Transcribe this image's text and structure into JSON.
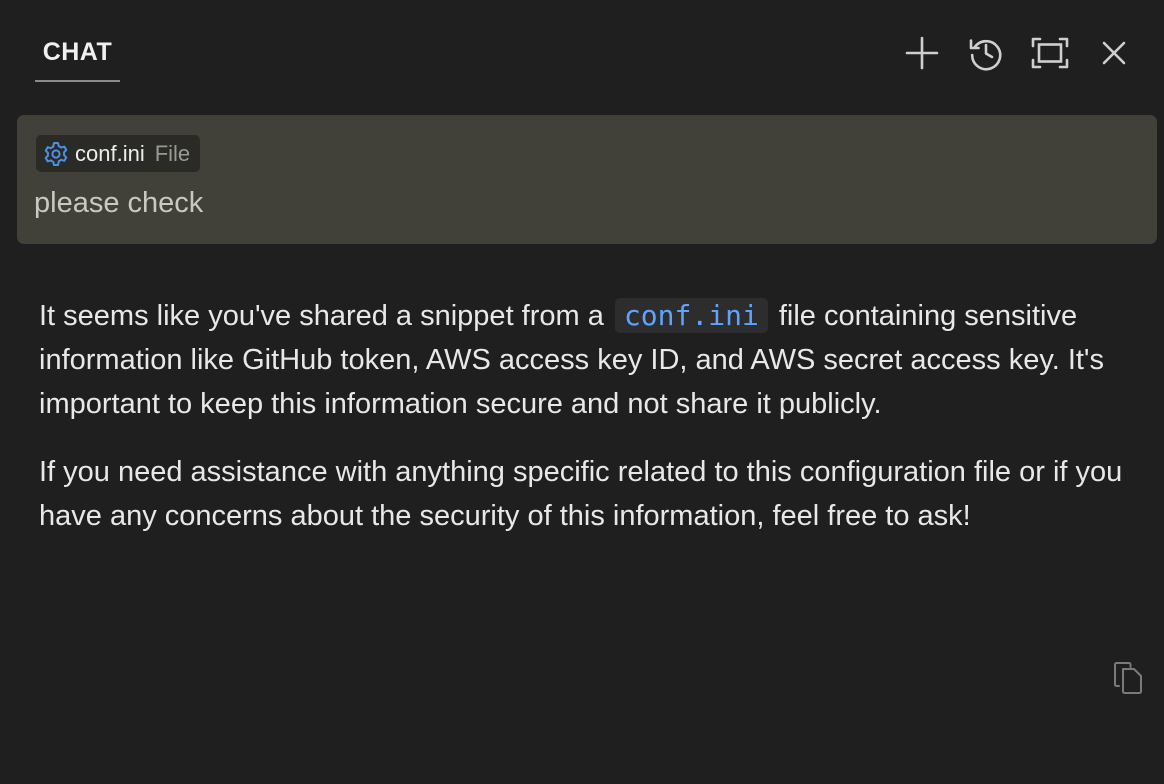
{
  "header": {
    "tab_label": "CHAT",
    "actions": {
      "new_chat_icon": "plus-icon",
      "history_icon": "history-icon",
      "maximize_icon": "maximize-icon",
      "close_icon": "close-icon"
    }
  },
  "request": {
    "attachment": {
      "icon": "gear-icon",
      "name": "conf.ini",
      "kind": "File"
    },
    "text": "please check"
  },
  "response": {
    "paragraph1_before": "It seems like you've shared a snippet from a",
    "paragraph1_code": "conf.ini",
    "paragraph1_after": "file containing sensitive information like GitHub token, AWS access key ID, and AWS secret access key. It's important to keep this information secure and not share it publicly.",
    "paragraph2": "If you need assistance with anything specific related to this configuration file or if you have any concerns about the security of this information, feel free to ask!",
    "copy_icon": "copy-icon"
  },
  "colors": {
    "background": "#1f1f1f",
    "request_box": "#414139",
    "chip_background": "#2a2a26",
    "code_accent": "#5ea4ff",
    "gear_accent": "#4d8fe6"
  }
}
